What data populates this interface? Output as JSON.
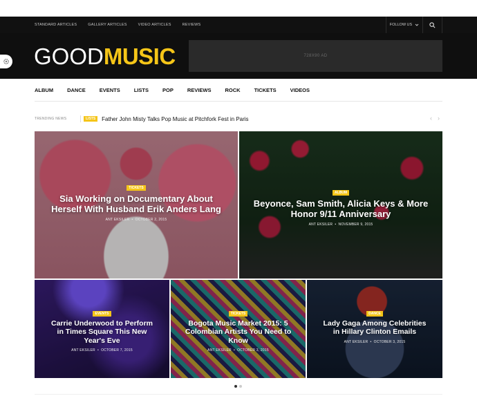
{
  "topbar": {
    "links": [
      "STANDARD ARTICLES",
      "GALLERY ARTICLES",
      "VIDEO ARTICLES",
      "REVIEWS"
    ],
    "follow_label": "FOLLOW US"
  },
  "header": {
    "logo_part1": "GOOD",
    "logo_part2": "MUSIC",
    "ad_label": "728X90 AD"
  },
  "mainnav": [
    "ALBUM",
    "DANCE",
    "EVENTS",
    "LISTS",
    "POP",
    "REVIEWS",
    "ROCK",
    "TICKETS",
    "VIDEOS"
  ],
  "trending": {
    "label": "TRENDING NEWS",
    "tag": "LISTS",
    "title": "Father John Misty Talks Pop Music at Pitchfork Fest in Paris"
  },
  "posts": [
    {
      "tag": "TICKETS",
      "title": "Sia Working on Documentary About Herself With Husband Erik Anders Lang",
      "author": "ANT EKSILER",
      "date": "OCTOBER 2, 2015"
    },
    {
      "tag": "ALBUM",
      "title": "Beyonce, Sam Smith, Alicia Keys & More Honor 9/11 Anniversary",
      "author": "ANT EKSILER",
      "date": "NOVEMBER 9, 2015"
    },
    {
      "tag": "EVENTS",
      "title": "Carrie Underwood to Perform in Times Square This New Year's Eve",
      "author": "ANT EKSILER",
      "date": "OCTOBER 7, 2015"
    },
    {
      "tag": "TICKETS",
      "title": "Bogota Music Market 2015: 5 Colombian Artists You Need to Know",
      "author": "ANT EKSILER",
      "date": "OCTOBER 3, 2015"
    },
    {
      "tag": "DANCE",
      "title": "Lady Gaga Among Celebrities in Hillary Clinton Emails",
      "author": "ANT EKSILER",
      "date": "OCTOBER 3, 2015"
    }
  ],
  "colors": {
    "accent": "#f5c518",
    "dark": "#111111"
  }
}
